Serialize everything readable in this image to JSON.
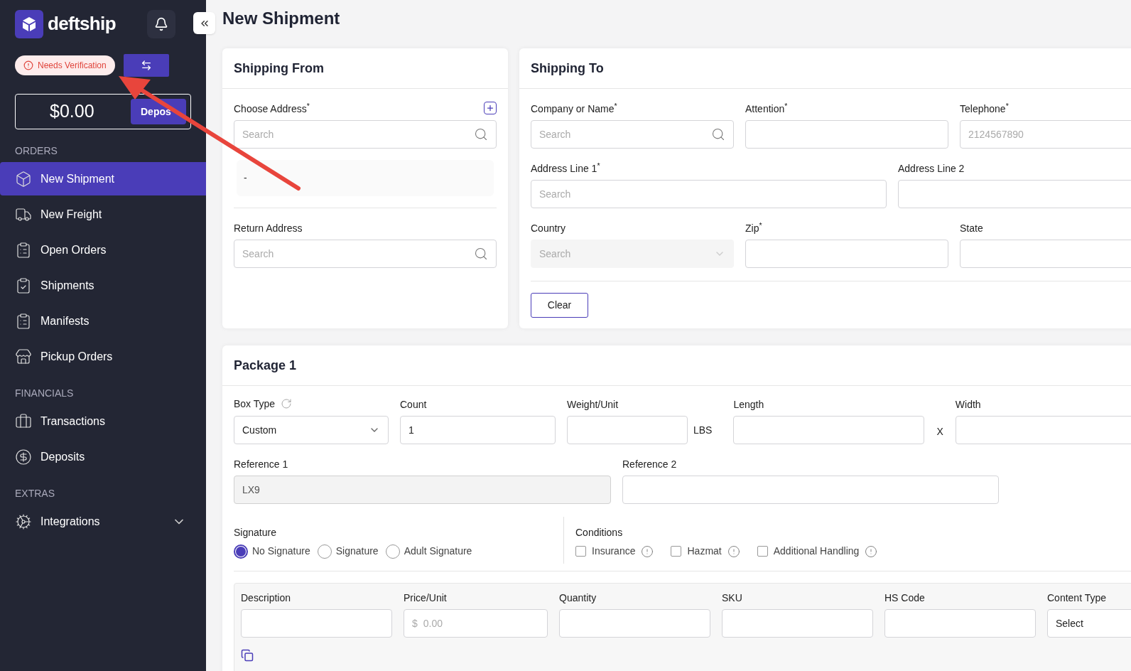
{
  "sidebar": {
    "logo": "deftship",
    "status_badge": "Needs Verification",
    "balance": "$0.00",
    "deposit_button": "Depos",
    "sections": [
      {
        "title": "ORDERS",
        "items": [
          {
            "label": "New Shipment",
            "selected": true,
            "kind": "link"
          },
          {
            "label": "New Freight",
            "selected": false,
            "kind": "link"
          },
          {
            "label": "Open Orders",
            "selected": false,
            "kind": "link"
          },
          {
            "label": "Shipments",
            "selected": false,
            "kind": "link"
          },
          {
            "label": "Manifests",
            "selected": false,
            "kind": "link"
          },
          {
            "label": "Pickup Orders",
            "selected": false,
            "kind": "link"
          }
        ]
      },
      {
        "title": "FINANCIALS",
        "items": [
          {
            "label": "Transactions",
            "selected": false,
            "kind": "link"
          },
          {
            "label": "Deposits",
            "selected": false,
            "kind": "link"
          }
        ]
      },
      {
        "title": "EXTRAS",
        "items": [
          {
            "label": "Integrations",
            "selected": false,
            "kind": "group"
          }
        ]
      }
    ]
  },
  "page_title": "New Shipment",
  "shipping_from": {
    "title": "Shipping From",
    "choose_address": {
      "label": "Choose Address$^{*}$",
      "placeholder": "Search"
    },
    "selected_address": "-",
    "return_address": {
      "label": "Return Address",
      "placeholder": "Search"
    }
  },
  "shipping_to": {
    "title": "Shipping To",
    "rows": [
      [
        {
          "label": "Company or Name$^{*}$",
          "placeholder": "Search",
          "kind": "search",
          "disabled": false
        },
        {
          "label": "Attention$^{*}$",
          "kind": "text",
          "disabled": false
        },
        {
          "label": "Telephone$^{*}$",
          "placeholder": "2124567890",
          "kind": "text",
          "disabled": false
        }
      ],
      [
        {
          "label": "Address Line 1$^{*}$",
          "placeholder": "Search",
          "kind": "text",
          "disabled": false
        },
        {
          "label": "Address Line 2",
          "kind": "text",
          "disabled": false
        }
      ],
      [
        {
          "label": "Country",
          "placeholder": "Search",
          "kind": "select",
          "disabled": true
        },
        {
          "label": "Zip$^{*}$",
          "kind": "text",
          "disabled": false
        },
        {
          "label": "State",
          "kind": "text",
          "disabled": false
        }
      ]
    ],
    "clear_button": "Clear"
  },
  "package": {
    "title": "Package 1",
    "box_type": {
      "label": "Box Type",
      "value": "Custom"
    },
    "count": {
      "label": "Count",
      "value": "1"
    },
    "weight": {
      "label": "Weight/Unit",
      "unit": "LBS"
    },
    "length": {
      "label": "Length"
    },
    "separator": "X",
    "width": {
      "label": "Width"
    },
    "reference_1": {
      "label": "Reference 1",
      "value": "LX9",
      "disabled": true
    },
    "reference_2": {
      "label": "Reference 2",
      "disabled": false
    },
    "signature": {
      "label": "Signature",
      "options": [
        {
          "label": "No Signature",
          "selected": true
        },
        {
          "label": "Signature",
          "selected": false
        },
        {
          "label": "Adult Signature",
          "selected": false
        }
      ]
    },
    "conditions": {
      "label": "Conditions",
      "options": [
        {
          "label": "Insurance",
          "checked": false
        },
        {
          "label": "Hazmat",
          "checked": false
        },
        {
          "label": "Additional Handling",
          "checked": false
        }
      ]
    },
    "items": {
      "columns": [
        {
          "label": "Description",
          "kind": "text"
        },
        {
          "label": "Price/Unit",
          "kind": "money",
          "prefix": "$",
          "placeholder": "0.00"
        },
        {
          "label": "Quantity",
          "kind": "text"
        },
        {
          "label": "SKU",
          "kind": "text"
        },
        {
          "label": "HS Code",
          "kind": "text"
        },
        {
          "label": "Content Type",
          "kind": "select",
          "value": "Select"
        }
      ]
    }
  }
}
